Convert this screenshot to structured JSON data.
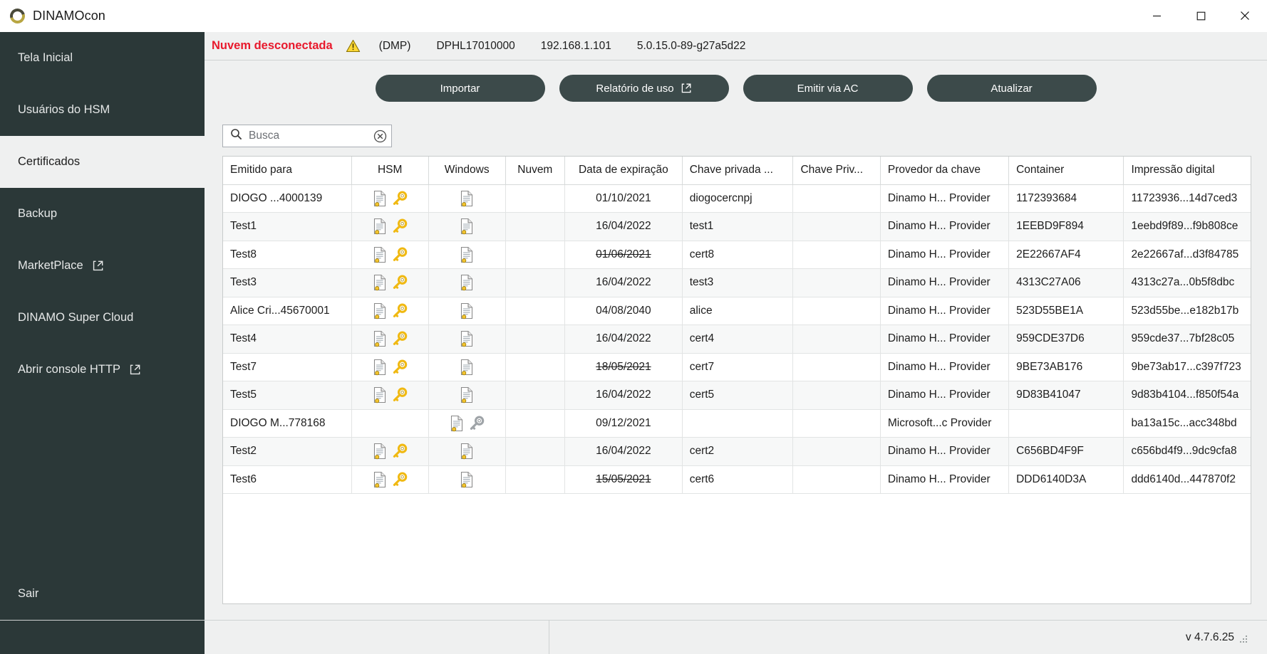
{
  "window": {
    "title": "DINAMOcon",
    "logo_icon": "dinamo-ring-logo",
    "minimize_label": "Minimizar",
    "maximize_label": "Maximizar",
    "close_label": "Fechar"
  },
  "sidebar": {
    "items": [
      {
        "label": "Tela Inicial",
        "name": "sidebar-item-tela-inicial",
        "active": false,
        "external": false
      },
      {
        "label": "Usuários do HSM",
        "name": "sidebar-item-usuarios-hsm",
        "active": false,
        "external": false
      },
      {
        "label": "Certificados",
        "name": "sidebar-item-certificados",
        "active": true,
        "external": false
      },
      {
        "label": "Backup",
        "name": "sidebar-item-backup",
        "active": false,
        "external": false
      },
      {
        "label": "MarketPlace",
        "name": "sidebar-item-marketplace",
        "active": false,
        "external": true
      },
      {
        "label": "DINAMO Super Cloud",
        "name": "sidebar-item-dinamo-super-cloud",
        "active": false,
        "external": false
      },
      {
        "label": "Abrir console HTTP",
        "name": "sidebar-item-abrir-console-http",
        "active": false,
        "external": true
      },
      {
        "label": "Sair",
        "name": "sidebar-item-sair",
        "active": false,
        "external": false
      }
    ]
  },
  "status": {
    "connection": "Nuvem desconectada",
    "warning_icon": "warning-triangle-icon",
    "mode": "(DMP)",
    "device": "DPHL17010000",
    "ip": "192.168.1.101",
    "firmware": "5.0.15.0-89-g27a5d22",
    "alert_color": "#e8192c"
  },
  "toolbar": {
    "import_label": "Importar",
    "usage_report_label": "Relatório de uso",
    "issue_ca_label": "Emitir via AC",
    "refresh_label": "Atualizar"
  },
  "search": {
    "placeholder": "Busca",
    "value": "",
    "search_icon": "search-icon",
    "clear_icon": "clear-circle-icon"
  },
  "table": {
    "columns": [
      "Emitido para",
      "HSM",
      "Windows",
      "Nuvem",
      "Data de expiração",
      "Chave privada ...",
      "Chave Priv...",
      "Provedor da chave",
      "Container",
      "Impressão digital"
    ],
    "rows": [
      {
        "issued_to": "DIOGO ...4000139",
        "hsm": "cert-key",
        "windows": "cert",
        "nuvem": "",
        "expiration": "01/10/2021",
        "expired": true,
        "revoked": false,
        "private_key": "diogocercnpj",
        "private_key2": "",
        "provider": "Dinamo H... Provider",
        "container": "1172393684",
        "thumbprint": "11723936...14d7ced3"
      },
      {
        "issued_to": "Test1",
        "hsm": "cert-key",
        "windows": "cert",
        "nuvem": "",
        "expiration": "16/04/2022",
        "expired": false,
        "revoked": false,
        "private_key": "test1",
        "private_key2": "",
        "provider": "Dinamo H... Provider",
        "container": "1EEBD9F894",
        "thumbprint": "1eebd9f89...f9b808ce"
      },
      {
        "issued_to": "Test8",
        "hsm": "cert-key",
        "windows": "cert",
        "nuvem": "",
        "expiration": "01/06/2021",
        "expired": true,
        "revoked": true,
        "private_key": "cert8",
        "private_key2": "",
        "provider": "Dinamo H... Provider",
        "container": "2E22667AF4",
        "thumbprint": "2e22667af...d3f84785"
      },
      {
        "issued_to": "Test3",
        "hsm": "cert-key",
        "windows": "cert",
        "nuvem": "",
        "expiration": "16/04/2022",
        "expired": false,
        "revoked": false,
        "private_key": "test3",
        "private_key2": "",
        "provider": "Dinamo H... Provider",
        "container": "4313C27A06",
        "thumbprint": "4313c27a...0b5f8dbc"
      },
      {
        "issued_to": "Alice Cri...45670001",
        "hsm": "cert-key",
        "windows": "cert",
        "nuvem": "",
        "expiration": "04/08/2040",
        "expired": false,
        "revoked": false,
        "private_key": "alice",
        "private_key2": "",
        "provider": "Dinamo H... Provider",
        "container": "523D55BE1A",
        "thumbprint": "523d55be...e182b17b"
      },
      {
        "issued_to": "Test4",
        "hsm": "cert-key",
        "windows": "cert",
        "nuvem": "",
        "expiration": "16/04/2022",
        "expired": false,
        "revoked": false,
        "private_key": "cert4",
        "private_key2": "",
        "provider": "Dinamo H... Provider",
        "container": "959CDE37D6",
        "thumbprint": "959cde37...7bf28c05"
      },
      {
        "issued_to": "Test7",
        "hsm": "cert-key",
        "windows": "cert",
        "nuvem": "",
        "expiration": "18/05/2021",
        "expired": true,
        "revoked": true,
        "private_key": "cert7",
        "private_key2": "",
        "provider": "Dinamo H... Provider",
        "container": "9BE73AB176",
        "thumbprint": "9be73ab17...c397f723"
      },
      {
        "issued_to": "Test5",
        "hsm": "cert-key",
        "windows": "cert",
        "nuvem": "",
        "expiration": "16/04/2022",
        "expired": false,
        "revoked": false,
        "private_key": "cert5",
        "private_key2": "",
        "provider": "Dinamo H... Provider",
        "container": "9D83B41047",
        "thumbprint": "9d83b4104...f850f54a"
      },
      {
        "issued_to": "DIOGO M...778168",
        "hsm": "",
        "windows": "cert-key-gray",
        "nuvem": "",
        "expiration": "09/12/2021",
        "expired": false,
        "revoked": false,
        "private_key": "",
        "private_key2": "",
        "provider": "Microsoft...c Provider",
        "container": "",
        "thumbprint": "ba13a15c...acc348bd"
      },
      {
        "issued_to": "Test2",
        "hsm": "cert-key",
        "windows": "cert",
        "nuvem": "",
        "expiration": "16/04/2022",
        "expired": false,
        "revoked": false,
        "private_key": "cert2",
        "private_key2": "",
        "provider": "Dinamo H... Provider",
        "container": "C656BD4F9F",
        "thumbprint": "c656bd4f9...9dc9cfa8"
      },
      {
        "issued_to": "Test6",
        "hsm": "cert-key",
        "windows": "cert",
        "nuvem": "",
        "expiration": "15/05/2021",
        "expired": true,
        "revoked": true,
        "private_key": "cert6",
        "private_key2": "",
        "provider": "Dinamo H... Provider",
        "container": "DDD6140D3A",
        "thumbprint": "ddd6140d...447870f2"
      }
    ]
  },
  "footer": {
    "version": "v 4.7.6.25"
  }
}
